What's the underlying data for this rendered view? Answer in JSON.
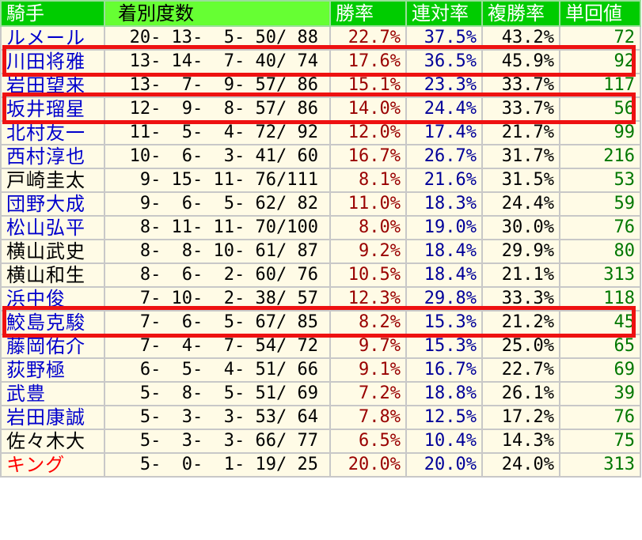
{
  "colors": {
    "header_bg": "#00cc00",
    "header_record_bg": "#66ff33",
    "row_bg": "#fffbe6",
    "highlight": "#ee1111",
    "win_rate": "#990000",
    "place_rate": "#000099",
    "show_rate": "#000000",
    "single_value": "#007700"
  },
  "headers": {
    "name": "騎手",
    "record": "着別度数",
    "win_rate": "勝率",
    "place_rate": "連対率",
    "show_rate": "複勝率",
    "single_value": "単回値"
  },
  "rows": [
    {
      "name": "ルメール",
      "name_color": "#0000cc",
      "record": "20- 13-  5- 50/ 88",
      "win_rate": "22.7%",
      "place_rate": "37.5%",
      "show_rate": "43.2%",
      "single_value": "72",
      "highlighted": false
    },
    {
      "name": "川田将雅",
      "name_color": "#0000cc",
      "record": "13- 14-  7- 40/ 74",
      "win_rate": "17.6%",
      "place_rate": "36.5%",
      "show_rate": "45.9%",
      "single_value": "92",
      "highlighted": true
    },
    {
      "name": "岩田望来",
      "name_color": "#0000cc",
      "record": "13-  7-  9- 57/ 86",
      "win_rate": "15.1%",
      "place_rate": "23.3%",
      "show_rate": "33.7%",
      "single_value": "117",
      "highlighted": false
    },
    {
      "name": "坂井瑠星",
      "name_color": "#0000cc",
      "record": "12-  9-  8- 57/ 86",
      "win_rate": "14.0%",
      "place_rate": "24.4%",
      "show_rate": "33.7%",
      "single_value": "56",
      "highlighted": true
    },
    {
      "name": "北村友一",
      "name_color": "#0000cc",
      "record": "11-  5-  4- 72/ 92",
      "win_rate": "12.0%",
      "place_rate": "17.4%",
      "show_rate": "21.7%",
      "single_value": "99",
      "highlighted": false
    },
    {
      "name": "西村淳也",
      "name_color": "#0000cc",
      "record": "10-  6-  3- 41/ 60",
      "win_rate": "16.7%",
      "place_rate": "26.7%",
      "show_rate": "31.7%",
      "single_value": "216",
      "highlighted": false
    },
    {
      "name": "戸崎圭太",
      "name_color": "#000000",
      "record": " 9- 15- 11- 76/111",
      "win_rate": "8.1%",
      "place_rate": "21.6%",
      "show_rate": "31.5%",
      "single_value": "53",
      "highlighted": false
    },
    {
      "name": "団野大成",
      "name_color": "#0000cc",
      "record": " 9-  6-  5- 62/ 82",
      "win_rate": "11.0%",
      "place_rate": "18.3%",
      "show_rate": "24.4%",
      "single_value": "59",
      "highlighted": false
    },
    {
      "name": "松山弘平",
      "name_color": "#0000cc",
      "record": " 8- 11- 11- 70/100",
      "win_rate": "8.0%",
      "place_rate": "19.0%",
      "show_rate": "30.0%",
      "single_value": "76",
      "highlighted": false
    },
    {
      "name": "横山武史",
      "name_color": "#000000",
      "record": " 8-  8- 10- 61/ 87",
      "win_rate": "9.2%",
      "place_rate": "18.4%",
      "show_rate": "29.9%",
      "single_value": "80",
      "highlighted": false
    },
    {
      "name": "横山和生",
      "name_color": "#000000",
      "record": " 8-  6-  2- 60/ 76",
      "win_rate": "10.5%",
      "place_rate": "18.4%",
      "show_rate": "21.1%",
      "single_value": "313",
      "highlighted": false
    },
    {
      "name": "浜中俊",
      "name_color": "#0000cc",
      "record": " 7- 10-  2- 38/ 57",
      "win_rate": "12.3%",
      "place_rate": "29.8%",
      "show_rate": "33.3%",
      "single_value": "118",
      "highlighted": false
    },
    {
      "name": "鮫島克駿",
      "name_color": "#0000cc",
      "record": " 7-  6-  5- 67/ 85",
      "win_rate": "8.2%",
      "place_rate": "15.3%",
      "show_rate": "21.2%",
      "single_value": "45",
      "highlighted": true
    },
    {
      "name": "藤岡佑介",
      "name_color": "#0000cc",
      "record": " 7-  4-  7- 54/ 72",
      "win_rate": "9.7%",
      "place_rate": "15.3%",
      "show_rate": "25.0%",
      "single_value": "65",
      "highlighted": false
    },
    {
      "name": "荻野極",
      "name_color": "#0000cc",
      "record": " 6-  5-  4- 51/ 66",
      "win_rate": "9.1%",
      "place_rate": "16.7%",
      "show_rate": "22.7%",
      "single_value": "69",
      "highlighted": false
    },
    {
      "name": "武豊",
      "name_color": "#0000cc",
      "record": " 5-  8-  5- 51/ 69",
      "win_rate": "7.2%",
      "place_rate": "18.8%",
      "show_rate": "26.1%",
      "single_value": "39",
      "highlighted": false
    },
    {
      "name": "岩田康誠",
      "name_color": "#0000cc",
      "record": " 5-  3-  3- 53/ 64",
      "win_rate": "7.8%",
      "place_rate": "12.5%",
      "show_rate": "17.2%",
      "single_value": "76",
      "highlighted": false
    },
    {
      "name": "佐々木大",
      "name_color": "#000000",
      "record": " 5-  3-  3- 66/ 77",
      "win_rate": "6.5%",
      "place_rate": "10.4%",
      "show_rate": "14.3%",
      "single_value": "75",
      "highlighted": false
    },
    {
      "name": "キング",
      "name_color": "#ff0000",
      "record": " 5-  0-  1- 19/ 25",
      "win_rate": "20.0%",
      "place_rate": "20.0%",
      "show_rate": "24.0%",
      "single_value": "313",
      "highlighted": false
    }
  ]
}
